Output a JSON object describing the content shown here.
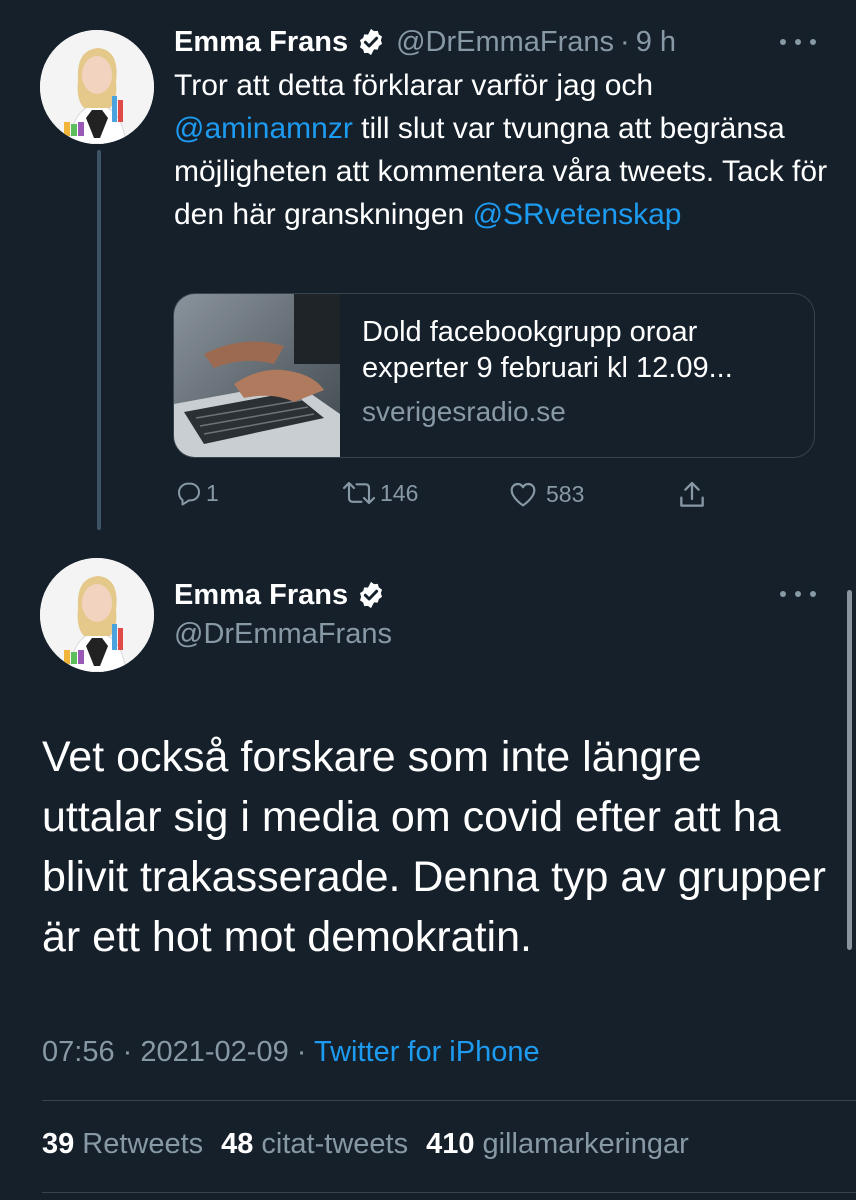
{
  "reply_tweet": {
    "author_name": "Emma Frans",
    "handle": "@DrEmmaFrans",
    "separator": "·",
    "time": "9 h",
    "text_parts": {
      "p1": "Tror att detta förklarar varför jag och ",
      "mention1": "@aminamnzr",
      "p2": " till slut var tvungna att begränsa möjligheten att kommentera våra tweets. Tack för den här granskningen ",
      "mention2": "@SRvetenskap"
    },
    "card": {
      "title": "Dold facebookgrupp oroar experter 9 februari kl 12.09...",
      "domain": "sverigesradio.se"
    },
    "actions": {
      "replies": "1",
      "retweets": "146",
      "likes": "583"
    }
  },
  "main_tweet": {
    "author_name": "Emma Frans",
    "handle": "@DrEmmaFrans",
    "text": "Vet också forskare som inte längre uttalar sig i media om covid efter att ha blivit trakasserade. Denna typ av grupper är ett hot mot demokratin.",
    "time": "07:56",
    "separator1": " · ",
    "date": "2021-02-09",
    "separator2": " · ",
    "source": "Twitter for iPhone",
    "stats": {
      "retweets_count": "39",
      "retweets_label": "Retweets",
      "quotes_count": "48",
      "quotes_label": "citat-tweets",
      "likes_count": "410",
      "likes_label": "gillamarkeringar"
    }
  },
  "colors": {
    "background": "#15202b",
    "text": "#ffffff",
    "secondary": "#8899a6",
    "link": "#1d9bf0",
    "border": "#38444d"
  }
}
